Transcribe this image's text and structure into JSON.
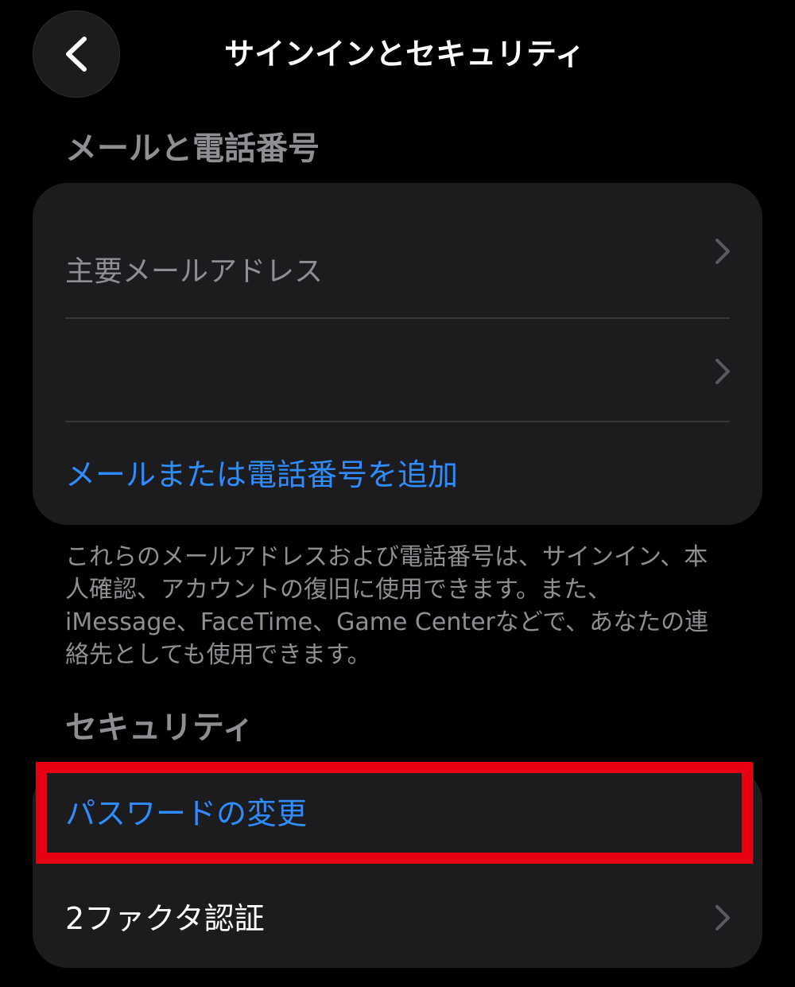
{
  "nav": {
    "title": "サインインとセキュリティ",
    "back_icon": "chevron-left-icon"
  },
  "email_section": {
    "header": "メールと電話番号",
    "rows": [
      {
        "label": "主要メールアドレス",
        "chevron": true
      },
      {
        "label": "",
        "chevron": true
      }
    ],
    "add_action": "メールまたは電話番号を追加",
    "footer": "これらのメールアドレスおよび電話番号は、サインイン、本人確認、アカウントの復旧に使用できます。また、iMessage、FaceTime、Game Centerなどで、あなたの連絡先としても使用できます。"
  },
  "security_section": {
    "header": "セキュリティ",
    "change_password": "パスワードの変更",
    "two_factor": "2ファクタ認証"
  },
  "colors": {
    "background": "#000000",
    "group_background": "#1c1c1e",
    "accent": "#2f8cff",
    "secondary_text": "#8e8e93",
    "highlight": "#e60012"
  }
}
